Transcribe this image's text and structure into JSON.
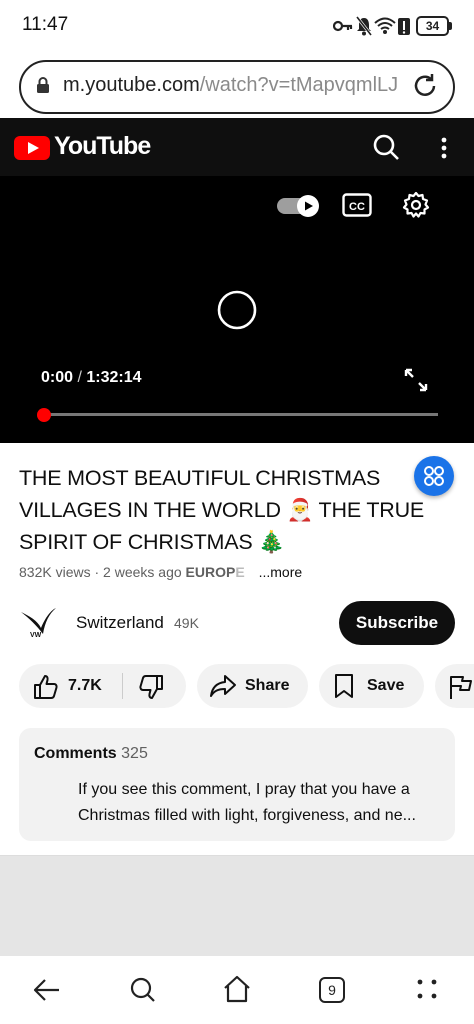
{
  "status_bar": {
    "time": "11:47",
    "battery": "34",
    "icons": [
      "vpn-key-icon",
      "mute-icon",
      "wifi-icon",
      "battery-saver-icon",
      "battery-icon"
    ]
  },
  "browser": {
    "url_host": "m.youtube.com",
    "url_path": "/watch?v=tMapvqmlLJ",
    "icons": [
      "lock-icon",
      "reload-icon"
    ]
  },
  "header": {
    "brand": "YouTube",
    "icons": [
      "youtube-logo-icon",
      "search-icon",
      "more-vert-icon"
    ],
    "brand_color": "#ff0000"
  },
  "player": {
    "current_time": "0:00",
    "duration": "1:32:14",
    "progress": 0,
    "autoplay": true,
    "icons": [
      "autoplay-toggle-icon",
      "captions-icon",
      "settings-gear-icon",
      "loading-spinner-icon",
      "fullscreen-icon"
    ]
  },
  "video": {
    "title": "THE MOST BEAUTIFUL CHRISTMAS VILLAGES IN THE WORLD 🎅 THE TRUE SPIRIT OF CHRISTMAS 🎄",
    "views": "832K views",
    "age": "· 2 weeks ago",
    "tag_visible": "EUROP",
    "tag_fade": "E",
    "more": "...more"
  },
  "channel": {
    "name": "Switzerland",
    "subscribers": "49K",
    "subscribe_label": "Subscribe"
  },
  "actions": {
    "likes": "7.7K",
    "share": "Share",
    "save": "Save"
  },
  "comments": {
    "title": "Comments",
    "count": "325",
    "top_comment": "If you see this comment, I pray that you have a Christmas filled with light, forgiveness, and ne..."
  },
  "bottom_nav": {
    "tabs_count": "9",
    "icons": [
      "back-icon",
      "search-icon",
      "home-icon",
      "tabs-icon",
      "menu-dots-icon"
    ]
  },
  "colors": {
    "accent_red": "#ff0000",
    "fab_blue": "#1a73e8",
    "dark": "#0f0f0f",
    "pill_bg": "#f2f2f2"
  }
}
